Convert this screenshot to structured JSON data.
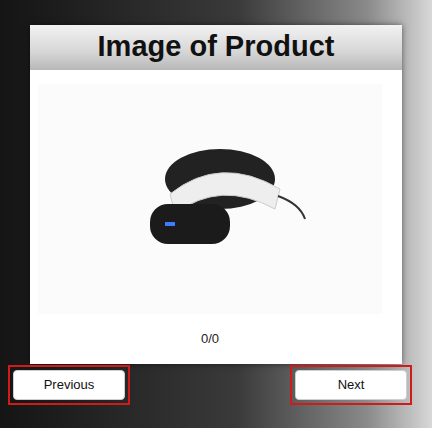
{
  "panel": {
    "title": "Image of Product",
    "counter": "0/0"
  },
  "buttons": [
    {
      "label": "Previous",
      "highlighted": true
    },
    {
      "label": "Next",
      "highlighted": true
    }
  ]
}
